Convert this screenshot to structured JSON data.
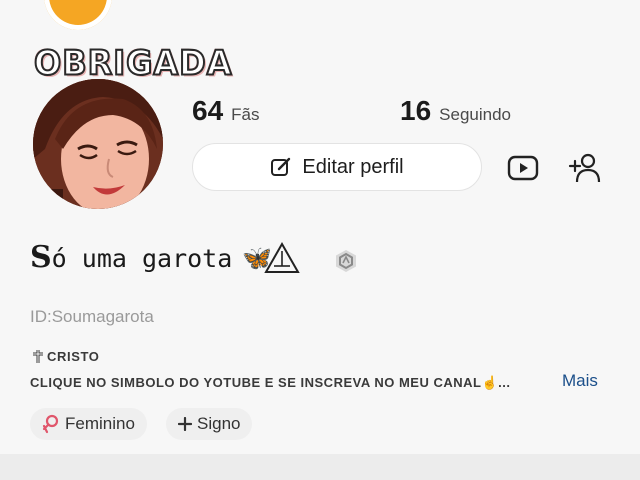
{
  "banner": {
    "text": "OBRIGADA"
  },
  "stats": {
    "fans": {
      "count": "64",
      "label": "Fãs"
    },
    "following": {
      "count": "16",
      "label": "Seguindo"
    }
  },
  "actions": {
    "edit_profile_label": "Editar perfil",
    "edit_icon": "edit-icon",
    "video_icon": "video-play-icon",
    "add_user_icon": "add-user-icon"
  },
  "profile": {
    "name_first": "S",
    "name_rest": "ó uma garota",
    "name_emoji": "🦋",
    "user_id": "ID:Soumagarota",
    "bio_line1": "CRISTO",
    "bio_line2": "CLIQUE NO SIMBOLO DO YOTUBE E SE INSCREVA NO MEU CANAL☝️...",
    "more_label": "Mais"
  },
  "tags": [
    {
      "label": "Feminino",
      "icon": "female-symbol-icon"
    },
    {
      "label": "Signo",
      "icon": "plus-icon"
    }
  ],
  "colors": {
    "more_link": "#1b4f8a",
    "banner_stroke": "#2a2a2a"
  }
}
